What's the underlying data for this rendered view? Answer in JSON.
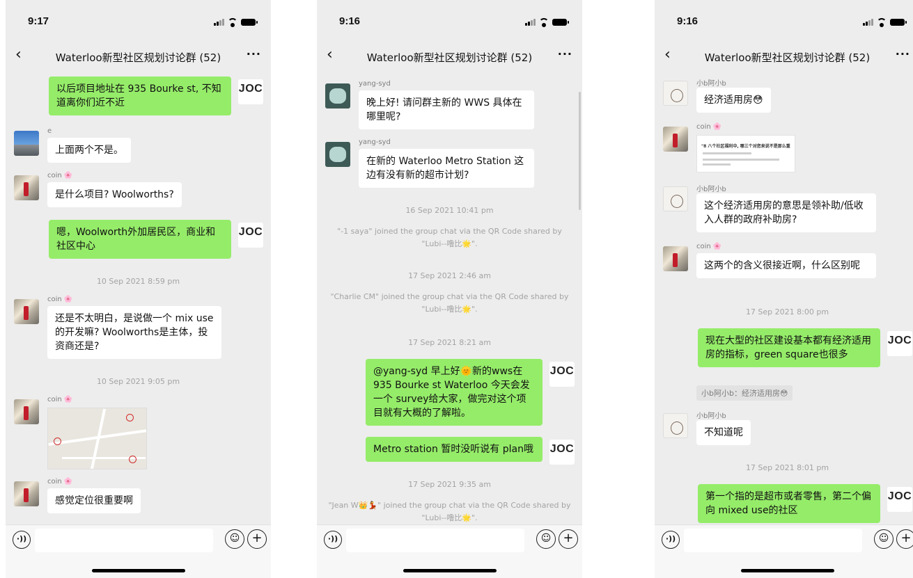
{
  "phones": [
    {
      "time": "9:17",
      "chat_title": "Waterloo新型社区规划讨论群 (52)",
      "messages": [
        {
          "text": "以后项目地址在 935 Bourke st, 不知道离你们近不近",
          "avatar_text": "JOC"
        },
        {
          "sender": "e",
          "text": "上面两个不是。"
        },
        {
          "sender": "coin 🌸",
          "text": "是什么项目? Woolworths?"
        },
        {
          "text": "嗯，Woolworth外加居民区，商业和社区中心",
          "avatar_text": "JOC"
        },
        {
          "timestamp": "10 Sep 2021 8:59 pm"
        },
        {
          "sender": "coin 🌸",
          "text": "还是不太明白，是说做一个 mix use 的开发嘛? Woolworths是主体，投资商还是?"
        },
        {
          "timestamp": "10 Sep 2021 9:05 pm"
        },
        {
          "sender": "coin 🌸",
          "image": "map-image"
        },
        {
          "sender": "coin 🌸",
          "text": "感觉定位很重要啊"
        }
      ]
    },
    {
      "time": "9:16",
      "chat_title": "Waterloo新型社区规划讨论群 (52)",
      "messages": [
        {
          "sender": "yang-syd",
          "text": "晚上好! 请问群主新的 WWS 具体在哪里呢?"
        },
        {
          "sender": "yang-syd",
          "text": "在新的 Waterloo Metro Station 这边有没有新的超市计划?"
        },
        {
          "timestamp": "16 Sep 2021 10:41 pm"
        },
        {
          "system": "\"-1 saya\" joined the group chat via the QR Code shared by \"Lubi--噜比🌟\"."
        },
        {
          "timestamp": "17 Sep 2021 2:46 am"
        },
        {
          "system": "\"Charlie CM\" joined the group chat via the QR Code shared by \"Lubi--噜比🌟\"."
        },
        {
          "timestamp": "17 Sep 2021 8:21 am"
        },
        {
          "text": "@yang-syd 早上好🌞新的wws在935 Bourke st Waterloo 今天会发一个 survey给大家，做完对这个项目就有大概的了解啦。",
          "avatar_text": "JOC"
        },
        {
          "text": "Metro station 暂时没听说有 plan哦",
          "avatar_text": "JOC"
        },
        {
          "timestamp": "17 Sep 2021 9:35 am"
        },
        {
          "system": "\"Jean W👑💃\" joined the group chat via the QR Code shared by \"Lubi--噜比🌟\"."
        }
      ]
    },
    {
      "time": "9:16",
      "chat_title": "Waterloo新型社区规划讨论群 (52)",
      "messages": [
        {
          "sender": "小b阿小b",
          "text": "经济适用房😳"
        },
        {
          "sender": "coin 🌸",
          "image": "survey-screenshot",
          "image_title": "\"8 八个社区福利中, 哪三个对您来说不是那么重"
        },
        {
          "sender": "小b阿小b",
          "text": "这个经济适用房的意思是领补助/低收入人群的政府补助房?"
        },
        {
          "sender": "coin 🌸",
          "text": "这两个的含义很接近啊，什么区别呢"
        },
        {
          "timestamp": "17 Sep 2021 8:00 pm"
        },
        {
          "text": "现在大型的社区建设基本都有经济适用房的指标，green square也很多",
          "avatar_text": "JOC",
          "quote": "小b阿小b：经济适用房😳"
        },
        {
          "sender": "小b阿小b",
          "text": "不知道呢"
        },
        {
          "timestamp": "17 Sep 2021 8:01 pm"
        },
        {
          "text": "第一个指的是超市或者零售，第二个偏向 mixed use的社区",
          "avatar_text": "JOC"
        }
      ]
    }
  ],
  "icons": {
    "back": "‹",
    "more": "···",
    "voice": "voice-icon",
    "emoji": "emoji-icon",
    "plus": "plus-icon"
  },
  "colors": {
    "chat_bg": "#ededed",
    "outgoing_bubble": "#95ec69",
    "incoming_bubble": "#ffffff"
  }
}
